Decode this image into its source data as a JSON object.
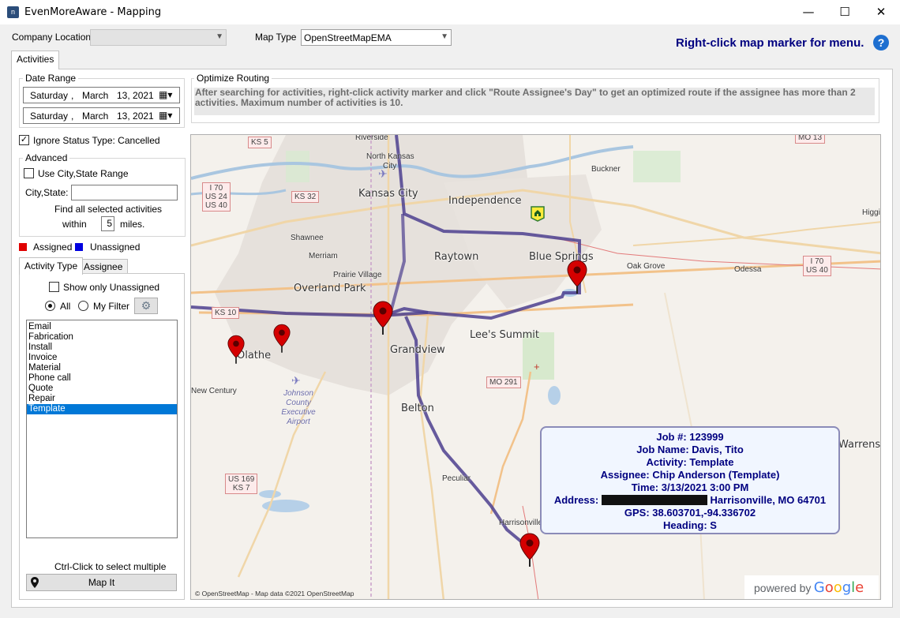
{
  "window": {
    "title": "EvenMoreAware - Mapping",
    "minimize": "—",
    "maximize": "☐",
    "close": "✕",
    "icon_glyph": "n"
  },
  "top": {
    "company_location_label": "Company Location",
    "company_location_value": "",
    "map_type_label": "Map Type",
    "map_type_value": "OpenStreetMapEMA",
    "hint": "Right-click map marker for menu.",
    "help_glyph": "?"
  },
  "tabs": {
    "activities": "Activities"
  },
  "date_range": {
    "title": "Date Range",
    "start": {
      "weekday": "Saturday",
      "sep": ",",
      "month": "March",
      "day_year": "13, 2021"
    },
    "end": {
      "weekday": "Saturday",
      "sep": ",",
      "month": "March",
      "day_year": "13, 2021"
    }
  },
  "optimize": {
    "title": "Optimize Routing",
    "text": "After searching for activities, right-click activity marker and click \"Route Assignee's Day\" to get an optimized route if the assignee has more than 2 activities.  Maximum number of activities is 10."
  },
  "ignore_status": {
    "label": "Ignore Status Type: Cancelled",
    "checked": true,
    "mark": "✓"
  },
  "advanced": {
    "title": "Advanced",
    "use_city_label": "Use City,State Range",
    "city_state_label": "City,State:",
    "city_state_value": "",
    "find_all_label": "Find all selected activities",
    "within_label": "within",
    "miles_value": "5",
    "miles_label": "miles."
  },
  "legend": {
    "assigned": "Assigned",
    "assigned_color": "#e00000",
    "unassigned": "Unassigned",
    "unassigned_color": "#0000e0"
  },
  "subtabs": {
    "activity_type": "Activity Type",
    "assignee": "Assignee"
  },
  "filter": {
    "show_unassigned": "Show only Unassigned",
    "all": "All",
    "my_filter": "My Filter",
    "gear_icon": "⚙"
  },
  "activity_types": [
    "Email",
    "Fabrication",
    "Install",
    "Invoice",
    "Material",
    "Phone call",
    "Quote",
    "Repair",
    "Template"
  ],
  "selected_activity_type": "Template",
  "ctrl_click_hint": "Ctrl-Click to select multiple",
  "map_it_label": "Map It",
  "map": {
    "attribution": "© OpenStreetMap - Map data ©2021 OpenStreetMap",
    "powered_by": "powered by",
    "google": [
      "G",
      "o",
      "o",
      "g",
      "l",
      "e"
    ],
    "google_colors": [
      "#4285f4",
      "#ea4335",
      "#fbbc05",
      "#4285f4",
      "#34a853",
      "#ea4335"
    ],
    "cities": {
      "riverside": "Riverside",
      "north_kc": "North Kansas",
      "north_kc2": "City",
      "kansas_city": "Kansas City",
      "independence": "Independence",
      "buckner": "Buckner",
      "higgi": "Higgi",
      "raytown": "Raytown",
      "blue_springs": "Blue Springs",
      "oak_grove": "Oak Grove",
      "odessa": "Odessa",
      "shawnee": "Shawnee",
      "merriam": "Merriam",
      "prairie_village": "Prairie Village",
      "overland_park": "Overland Park",
      "lees_summit": "Lee's Summit",
      "grandview": "Grandview",
      "olathe": "Olathe",
      "new_century": "New Century",
      "johnson_airport": "Johnson County Executive Airport",
      "belton": "Belton",
      "peculiar": "Peculiar",
      "harrisonville": "Harrisonville",
      "warrensb": "Warrensb"
    },
    "shields": {
      "ks5": "KS 5",
      "i70_w": "I 70\nUS 24\nUS 40",
      "ks32": "KS 32",
      "mo13": "MO 13",
      "i70_e": "I 70\nUS 40",
      "ks10": "KS 10",
      "mo291": "MO 291",
      "us169": "US 169\nKS 7"
    }
  },
  "popup": {
    "job": "Job #: 123999",
    "job_name": "Job Name: Davis, Tito",
    "activity": "Activity: Template",
    "assignee": "Assignee: Chip Anderson (Template)",
    "time": "Time: 3/13/2021 3:00 PM",
    "address_label": "Address:",
    "address_city": "Harrisonville, MO 64701",
    "gps": "GPS: 38.603701,-94.336702",
    "heading": "Heading: S"
  }
}
